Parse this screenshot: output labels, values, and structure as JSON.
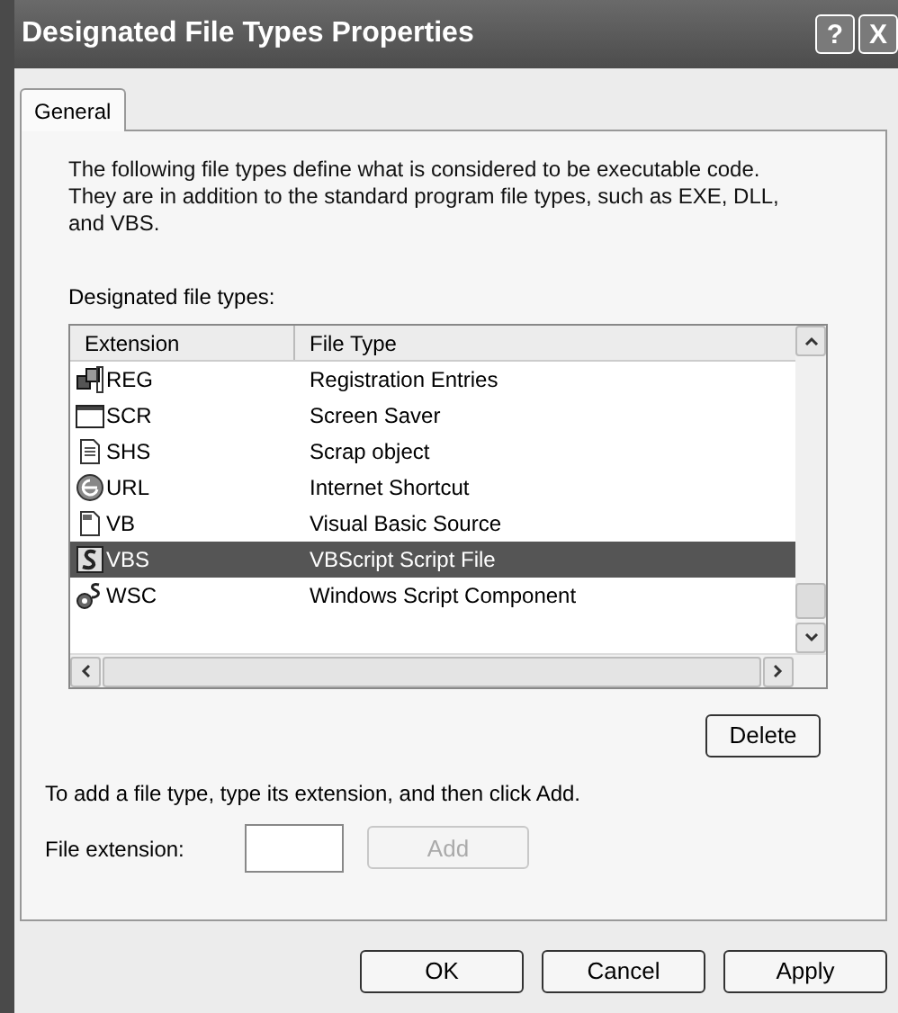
{
  "window": {
    "title": "Designated File Types Properties",
    "controls": [
      "?",
      "X"
    ]
  },
  "tabs": [
    {
      "label": "General",
      "selected": true
    }
  ],
  "description": "The following file types define what is considered to be executable code. They are in addition to the standard program file types, such as EXE, DLL, and VBS.",
  "list_label": "Designated file types:",
  "table": {
    "columns": [
      "Extension",
      "File Type"
    ],
    "rows": [
      {
        "kind": "registry",
        "extension": "REG",
        "file_type": "Registration Entries",
        "selected": false
      },
      {
        "kind": "screen",
        "extension": "SCR",
        "file_type": "Screen Saver",
        "selected": false
      },
      {
        "kind": "document",
        "extension": "SHS",
        "file_type": "Scrap object",
        "selected": false
      },
      {
        "kind": "web",
        "extension": "URL",
        "file_type": "Internet Shortcut",
        "selected": false
      },
      {
        "kind": "code",
        "extension": "VB",
        "file_type": "Visual Basic Source",
        "selected": false
      },
      {
        "kind": "script",
        "extension": "VBS",
        "file_type": "VBScript Script File",
        "selected": true
      },
      {
        "kind": "component",
        "extension": "WSC",
        "file_type": "Windows Script Component",
        "selected": false
      }
    ]
  },
  "delete_button": "Delete",
  "add_hint": "To add a file type, type its extension, and then click Add.",
  "extension_field": {
    "label": "File extension:"
  },
  "add_button": {
    "label": "Add",
    "disabled": true
  },
  "buttons": [
    "OK",
    "Cancel",
    "Apply"
  ]
}
